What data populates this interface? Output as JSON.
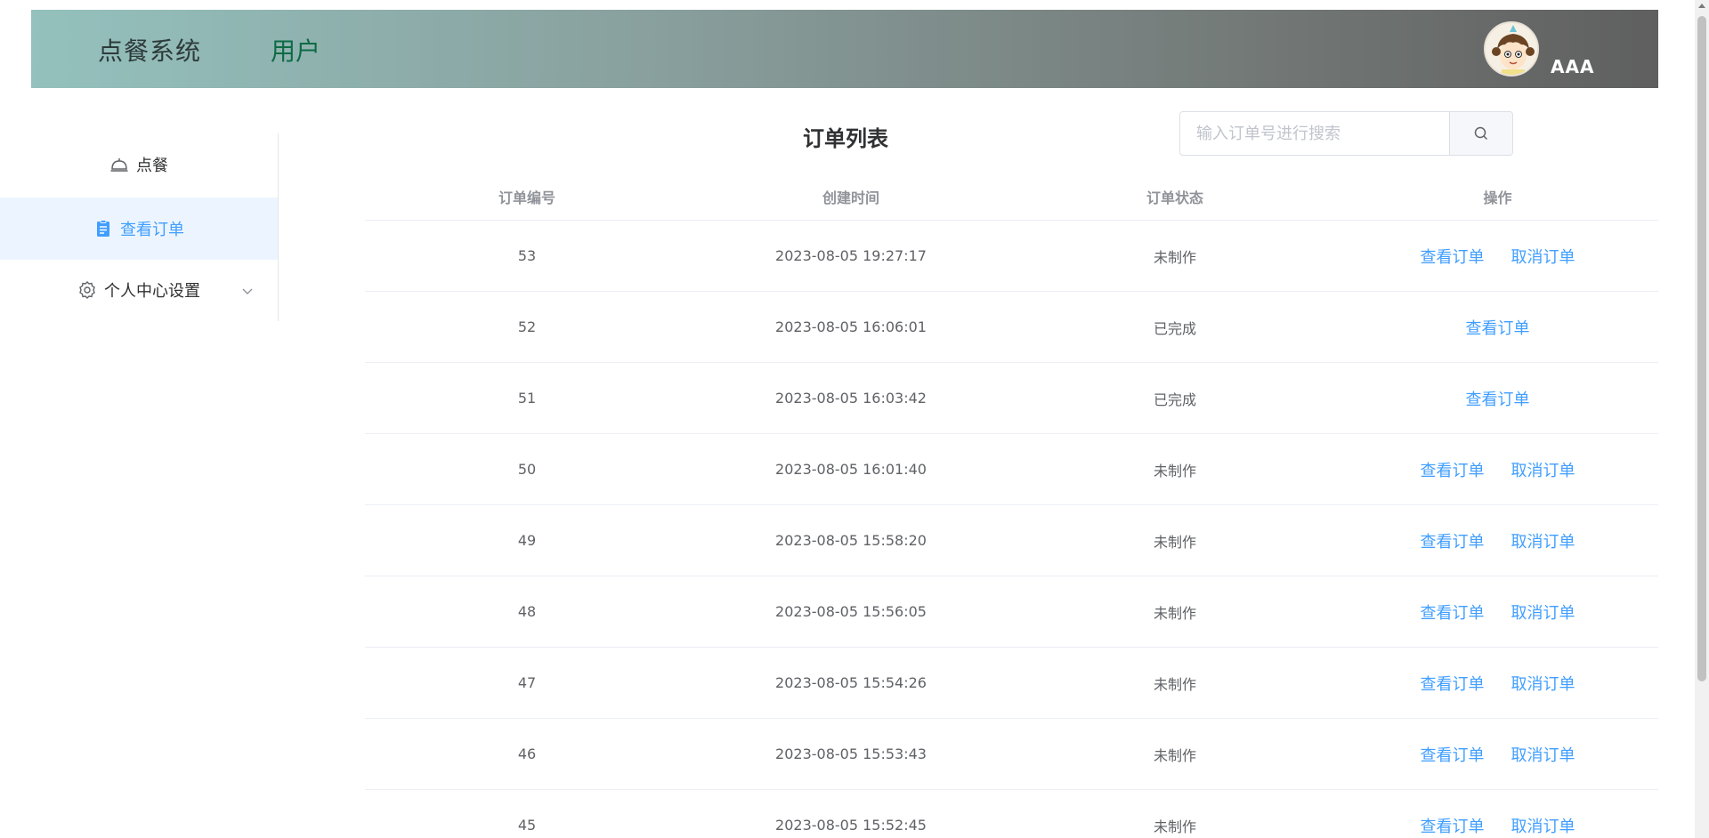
{
  "header": {
    "brand": "点餐系统",
    "role": "用户",
    "username": "AAA"
  },
  "sidebar": {
    "items": [
      {
        "label": "点餐",
        "icon": "food-bell-icon"
      },
      {
        "label": "查看订单",
        "icon": "clipboard-icon"
      },
      {
        "label": "个人中心设置",
        "icon": "gear-icon"
      }
    ]
  },
  "main": {
    "title": "订单列表",
    "search_placeholder": "输入订单号进行搜索",
    "columns": [
      "订单编号",
      "创建时间",
      "订单状态",
      "操作"
    ],
    "actions": {
      "view": "查看订单",
      "cancel": "取消订单"
    },
    "rows": [
      {
        "id": "53",
        "time": "2023-08-05 19:27:17",
        "status": "未制作"
      },
      {
        "id": "52",
        "time": "2023-08-05 16:06:01",
        "status": "已完成"
      },
      {
        "id": "51",
        "time": "2023-08-05 16:03:42",
        "status": "已完成"
      },
      {
        "id": "50",
        "time": "2023-08-05 16:01:40",
        "status": "未制作"
      },
      {
        "id": "49",
        "time": "2023-08-05 15:58:20",
        "status": "未制作"
      },
      {
        "id": "48",
        "time": "2023-08-05 15:56:05",
        "status": "未制作"
      },
      {
        "id": "47",
        "time": "2023-08-05 15:54:26",
        "status": "未制作"
      },
      {
        "id": "46",
        "time": "2023-08-05 15:53:43",
        "status": "未制作"
      },
      {
        "id": "45",
        "time": "2023-08-05 15:52:45",
        "status": "未制作"
      }
    ]
  },
  "colors": {
    "accent": "#409eff",
    "active_bg": "#ecf5ff",
    "header_start": "#94c1bd",
    "header_end": "#5f5f5f"
  }
}
